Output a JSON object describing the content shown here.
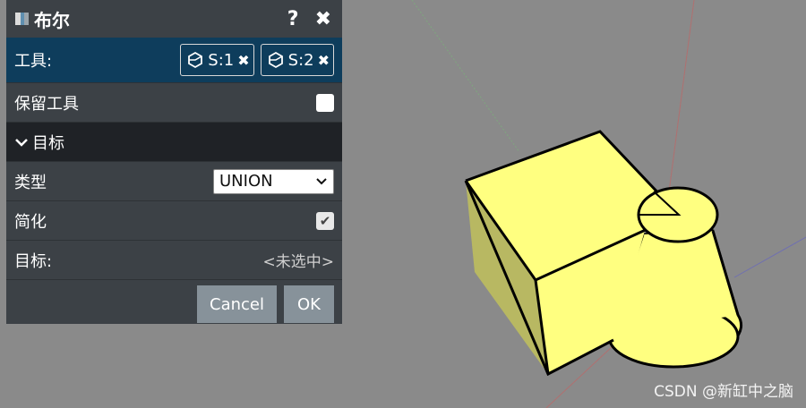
{
  "panel": {
    "title": "布尔",
    "help_label": "?",
    "close_label": "✖",
    "tools": {
      "label": "工具:",
      "chips": [
        {
          "name": "S:1",
          "remove": "✖"
        },
        {
          "name": "S:2",
          "remove": "✖"
        }
      ]
    },
    "keep_tools": {
      "label": "保留工具",
      "checked": false
    },
    "target_section": {
      "label": "目标",
      "expanded": true
    },
    "type": {
      "label": "类型",
      "value": "UNION"
    },
    "simplify": {
      "label": "简化",
      "checked": true,
      "check_glyph": "✔"
    },
    "target": {
      "label": "目标:",
      "value": "<未选中>"
    },
    "buttons": {
      "cancel": "Cancel",
      "ok": "OK"
    }
  },
  "viewport": {
    "background": "#8a8a8a",
    "solid_fill": "#ffff80",
    "solid_shade": "#b8b862"
  },
  "watermark": "CSDN @新缸中之脑"
}
